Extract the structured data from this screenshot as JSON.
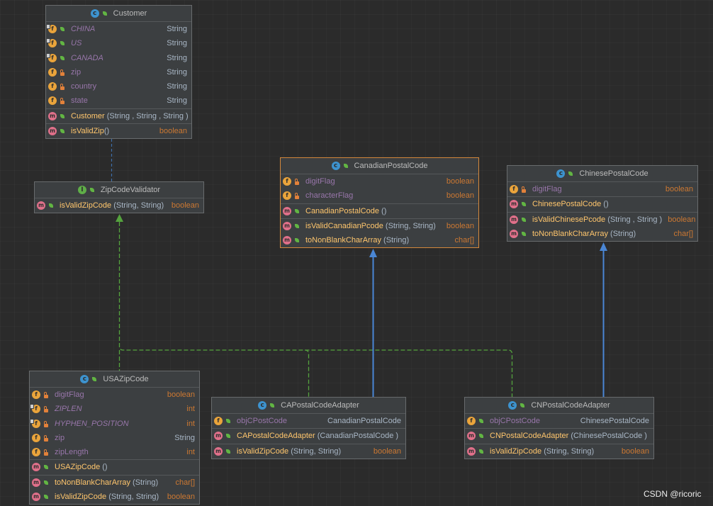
{
  "theme": {
    "background": "#2b2b2b",
    "class_background": "#3c3f41",
    "field_name": "#9876aa",
    "method_name": "#ffc66d",
    "reference_type": "#a9b7c6",
    "primitive_type": "#cc7832",
    "selection_border": "#d4883c",
    "realization_line": "#55a33e",
    "inheritance_line": "#4a86d4",
    "dependency_line": "#3f6ea8"
  },
  "diagram": {
    "classes": [
      {
        "name": "Customer",
        "icon": "class-icon",
        "fields": [
          {
            "name": "CHINA",
            "type": "String",
            "visibility": "public-icon",
            "static": true
          },
          {
            "name": "US",
            "type": "String",
            "visibility": "public-icon",
            "static": true
          },
          {
            "name": "CANADA",
            "type": "String",
            "visibility": "public-icon",
            "static": true
          },
          {
            "name": "zip",
            "type": "String",
            "visibility": "private-icon"
          },
          {
            "name": "country",
            "type": "String",
            "visibility": "private-icon"
          },
          {
            "name": "state",
            "type": "String",
            "visibility": "private-icon"
          }
        ],
        "constructors": [
          {
            "name": "Customer",
            "params": " (String , String , String )",
            "visibility": "public-icon"
          }
        ],
        "methods": [
          {
            "name": "isValidZip",
            "params": "()",
            "type": "boolean",
            "visibility": "public-icon"
          }
        ]
      },
      {
        "name": "ZipCodeValidator",
        "icon": "interface-icon",
        "methods": [
          {
            "name": "isValidZipCode",
            "params": " (String, String)",
            "type": "boolean",
            "visibility": "public-icon"
          }
        ]
      },
      {
        "name": "CanadianPostalCode",
        "icon": "class-icon",
        "selected": true,
        "fields": [
          {
            "name": "digitFlag",
            "type": "boolean",
            "visibility": "private-icon"
          },
          {
            "name": "characterFlag",
            "type": "boolean",
            "visibility": "private-icon"
          }
        ],
        "constructors": [
          {
            "name": "CanadianPostalCode",
            "params": " ()",
            "visibility": "public-icon"
          }
        ],
        "methods": [
          {
            "name": "isValidCanadianPcode",
            "params": " (String, String)",
            "type": "boolean",
            "visibility": "public-icon"
          },
          {
            "name": "toNonBlankCharArray",
            "params": " (String)",
            "type": "char[]",
            "visibility": "public-icon"
          }
        ]
      },
      {
        "name": "ChinesePostalCode",
        "icon": "class-icon",
        "fields": [
          {
            "name": "digitFlag",
            "type": "boolean",
            "visibility": "private-icon"
          }
        ],
        "constructors": [
          {
            "name": "ChinesePostalCode",
            "params": " ()",
            "visibility": "public-icon"
          }
        ],
        "methods": [
          {
            "name": "isValidChinesePcode",
            "params": " (String , String )",
            "type": "boolean",
            "visibility": "public-icon"
          },
          {
            "name": "toNonBlankCharArray",
            "params": " (String)",
            "type": "char[]",
            "visibility": "public-icon"
          }
        ]
      },
      {
        "name": "USAZipCode",
        "icon": "class-icon",
        "fields": [
          {
            "name": "digitFlag",
            "type": "boolean",
            "visibility": "private-icon"
          },
          {
            "name": "ZIPLEN",
            "type": "int",
            "visibility": "private-icon",
            "static": true
          },
          {
            "name": "HYPHEN_POSITION",
            "type": "int",
            "visibility": "private-icon",
            "static": true
          },
          {
            "name": "zip",
            "type": "String",
            "visibility": "private-icon"
          },
          {
            "name": "zipLength",
            "type": "int",
            "visibility": "private-icon"
          }
        ],
        "constructors": [
          {
            "name": "USAZipCode",
            "params": " ()",
            "visibility": "public-icon"
          }
        ],
        "methods": [
          {
            "name": "toNonBlankCharArray",
            "params": " (String)",
            "type": "char[]",
            "visibility": "public-icon"
          },
          {
            "name": "isValidZipCode",
            "params": " (String, String)",
            "type": "boolean",
            "visibility": "public-icon"
          }
        ]
      },
      {
        "name": "CAPostalCodeAdapter",
        "icon": "class-icon",
        "fields": [
          {
            "name": "objCPostCode",
            "type": "CanadianPostalCode",
            "visibility": "public-icon"
          }
        ],
        "constructors": [
          {
            "name": "CAPostalCodeAdapter",
            "params": " (CanadianPostalCode )",
            "visibility": "public-icon"
          }
        ],
        "methods": [
          {
            "name": "isValidZipCode",
            "params": " (String, String)",
            "type": "boolean",
            "visibility": "public-icon"
          }
        ]
      },
      {
        "name": "CNPostalCodeAdapter",
        "icon": "class-icon",
        "fields": [
          {
            "name": "objCPostCode",
            "type": "ChinesePostalCode",
            "visibility": "public-icon"
          }
        ],
        "constructors": [
          {
            "name": "CNPostalCodeAdapter",
            "params": " (ChinesePostalCode )",
            "visibility": "public-icon"
          }
        ],
        "methods": [
          {
            "name": "isValidZipCode",
            "params": " (String, String)",
            "type": "boolean",
            "visibility": "public-icon"
          }
        ]
      }
    ]
  },
  "watermark": "CSDN @ricoric"
}
